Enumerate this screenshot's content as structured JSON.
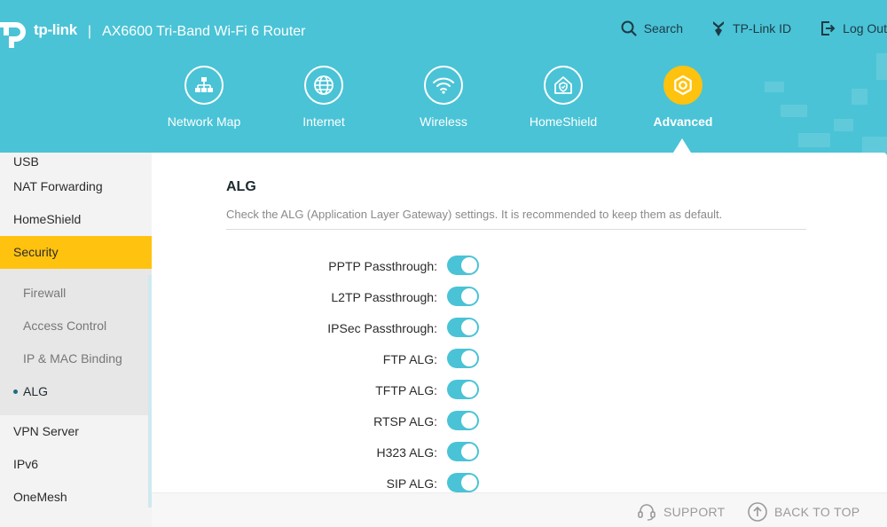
{
  "header": {
    "brand": "tp-link",
    "separator": "|",
    "product": "AX6600 Tri-Band Wi-Fi 6 Router",
    "actions": {
      "search": "Search",
      "account": "TP-Link ID",
      "logout": "Log Out"
    }
  },
  "nav": {
    "items": [
      {
        "label": "Network Map",
        "icon": "network-map-icon"
      },
      {
        "label": "Internet",
        "icon": "globe-icon"
      },
      {
        "label": "Wireless",
        "icon": "wifi-icon"
      },
      {
        "label": "HomeShield",
        "icon": "home-shield-icon"
      },
      {
        "label": "Advanced",
        "icon": "advanced-gear-icon",
        "active": true
      }
    ]
  },
  "sidebar": {
    "items_top": [
      "USB",
      "NAT Forwarding",
      "HomeShield"
    ],
    "active": "Security",
    "subitems": [
      "Firewall",
      "Access Control",
      "IP & MAC Binding"
    ],
    "current_subitem": "ALG",
    "items_bottom": [
      "VPN Server",
      "IPv6",
      "OneMesh"
    ]
  },
  "main": {
    "title": "ALG",
    "description": "Check the ALG (Application Layer Gateway) settings. It is recommended to keep them as default.",
    "settings": [
      {
        "label": "PPTP Passthrough:",
        "enabled": true
      },
      {
        "label": "L2TP Passthrough:",
        "enabled": true
      },
      {
        "label": "IPSec Passthrough:",
        "enabled": true
      },
      {
        "label": "FTP ALG:",
        "enabled": true
      },
      {
        "label": "TFTP ALG:",
        "enabled": true
      },
      {
        "label": "RTSP ALG:",
        "enabled": true
      },
      {
        "label": "H323 ALG:",
        "enabled": true
      },
      {
        "label": "SIP ALG:",
        "enabled": true
      }
    ]
  },
  "footer": {
    "support": "SUPPORT",
    "back_to_top": "BACK TO TOP"
  },
  "colors": {
    "accent": "#4ac3d6",
    "active": "#ffc20e"
  }
}
